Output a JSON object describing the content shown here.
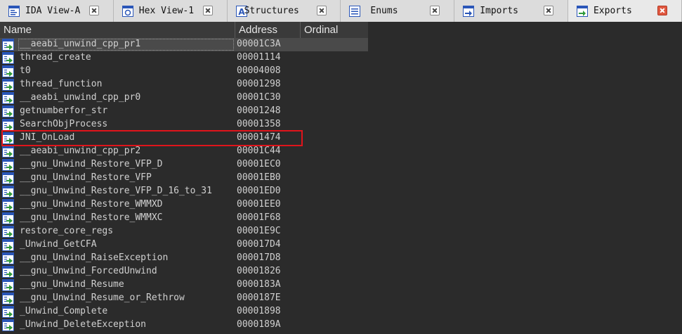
{
  "tabs": [
    {
      "label": "IDA View-A",
      "icon": "disassembly-view-icon",
      "active": false
    },
    {
      "label": "Hex View-1",
      "icon": "hex-view-icon",
      "active": false
    },
    {
      "label": "Structures",
      "icon": "structures-icon",
      "active": false
    },
    {
      "label": "Enums",
      "icon": "enums-icon",
      "active": false
    },
    {
      "label": "Imports",
      "icon": "imports-icon",
      "active": false
    },
    {
      "label": "Exports",
      "icon": "exports-icon",
      "active": true
    }
  ],
  "columns": {
    "name": "Name",
    "address": "Address",
    "ordinal": "Ordinal"
  },
  "rows": [
    {
      "name": "__aeabi_unwind_cpp_pr1",
      "address": "00001C3A"
    },
    {
      "name": "thread_create",
      "address": "00001114"
    },
    {
      "name": "t0",
      "address": "00004008"
    },
    {
      "name": "thread_function",
      "address": "00001298"
    },
    {
      "name": "__aeabi_unwind_cpp_pr0",
      "address": "00001C30"
    },
    {
      "name": "getnumberfor_str",
      "address": "00001248"
    },
    {
      "name": "SearchObjProcess",
      "address": "00001358"
    },
    {
      "name": "JNI_OnLoad",
      "address": "00001474"
    },
    {
      "name": "__aeabi_unwind_cpp_pr2",
      "address": "00001C44"
    },
    {
      "name": "__gnu_Unwind_Restore_VFP_D",
      "address": "00001EC0"
    },
    {
      "name": "__gnu_Unwind_Restore_VFP",
      "address": "00001EB0"
    },
    {
      "name": "__gnu_Unwind_Restore_VFP_D_16_to_31",
      "address": "00001ED0"
    },
    {
      "name": "__gnu_Unwind_Restore_WMMXD",
      "address": "00001EE0"
    },
    {
      "name": "__gnu_Unwind_Restore_WMMXC",
      "address": "00001F68"
    },
    {
      "name": "restore_core_regs",
      "address": "00001E9C"
    },
    {
      "name": "_Unwind_GetCFA",
      "address": "000017D4"
    },
    {
      "name": "__gnu_Unwind_RaiseException",
      "address": "000017D8"
    },
    {
      "name": "__gnu_Unwind_ForcedUnwind",
      "address": "00001826"
    },
    {
      "name": "__gnu_Unwind_Resume",
      "address": "0000183A"
    },
    {
      "name": "__gnu_Unwind_Resume_or_Rethrow",
      "address": "0000187E"
    },
    {
      "name": "_Unwind_Complete",
      "address": "00001898"
    },
    {
      "name": "_Unwind_DeleteException",
      "address": "0000189A"
    }
  ],
  "selected_row": 0,
  "highlighted_row": 7,
  "colors": {
    "background": "#2b2b2b",
    "highlight_border": "#e0141b",
    "active_tab_close": "#e0573f"
  }
}
